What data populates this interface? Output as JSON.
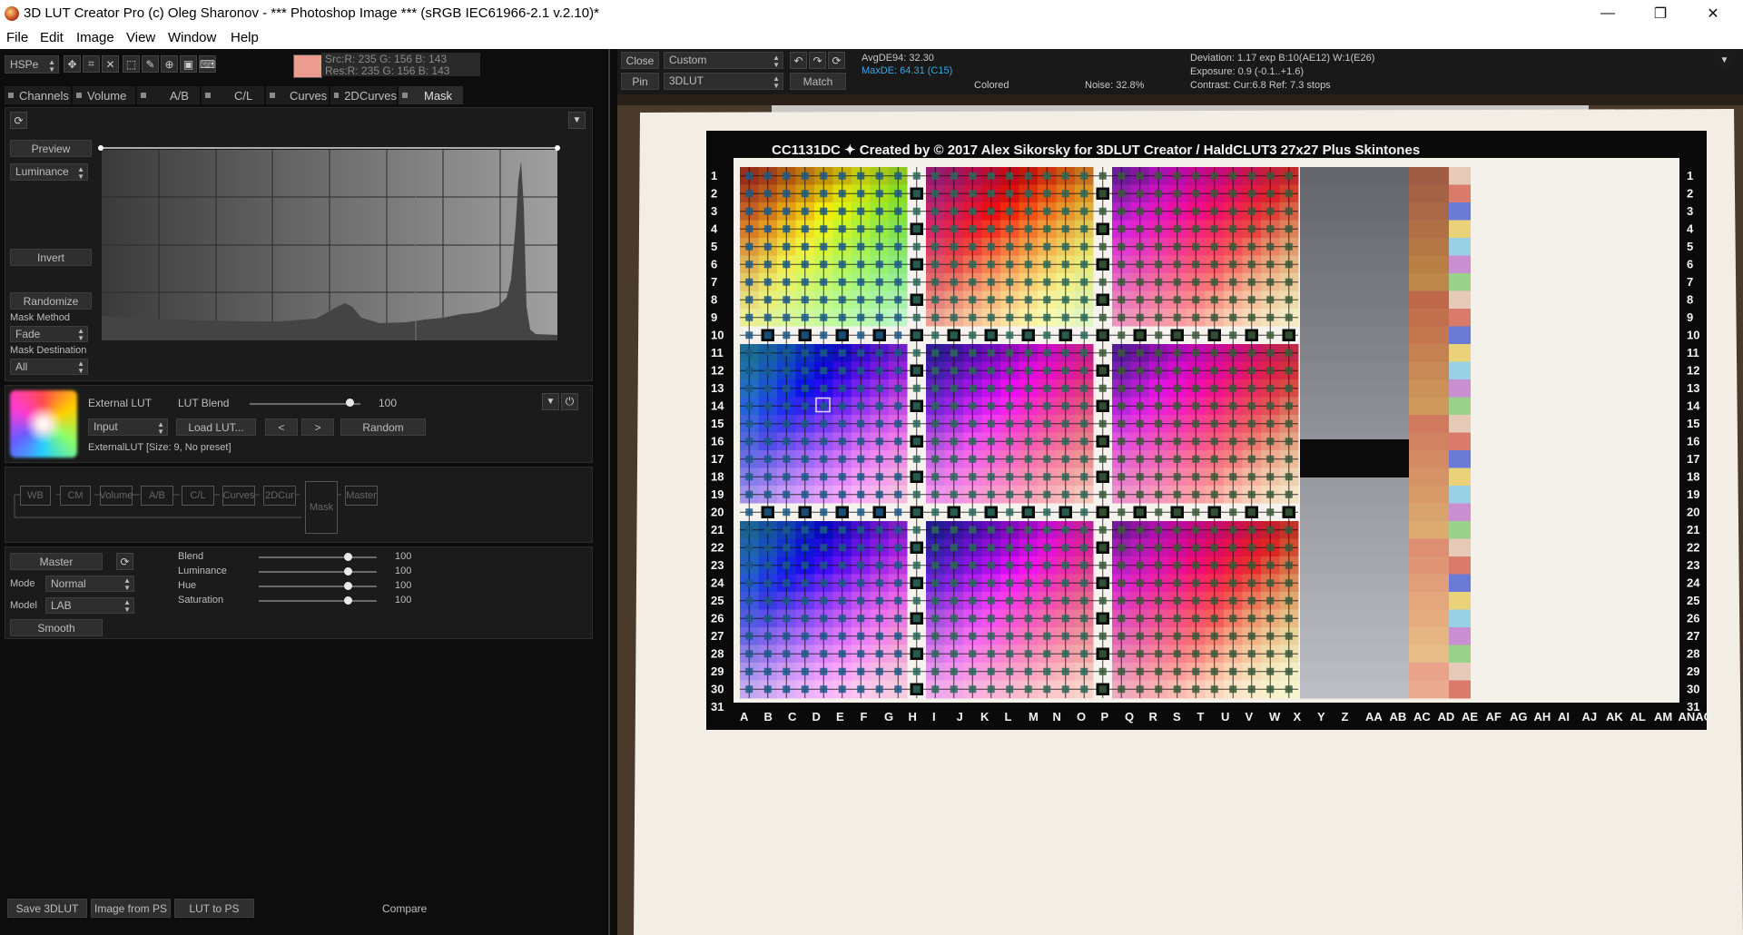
{
  "window": {
    "title": "3D LUT Creator Pro (c) Oleg Sharonov - *** Photoshop Image *** (sRGB IEC61966-2.1 v.2.10)*",
    "min_glyph": "—",
    "max_glyph": "❐",
    "close_glyph": "✕"
  },
  "menu": [
    "File",
    "Edit",
    "Image",
    "View",
    "Window",
    "Help"
  ],
  "toolbar": {
    "colorspace": "HSPe",
    "swatch_color": "#eb9c8f",
    "src_readout": "Src:R: 235  G: 156  B: 143",
    "res_readout": "Res:R: 235  G: 156  B: 143"
  },
  "tabs": [
    "Channels",
    "Volume",
    "A/B",
    "C/L",
    "Curves",
    "2DCurves",
    "Mask"
  ],
  "mask": {
    "preview": "Preview",
    "channel": "Luminance",
    "invert": "Invert",
    "randomize": "Randomize",
    "method_label": "Mask Method",
    "method_value": "Fade",
    "dest_label": "Mask Destination",
    "dest_value": "All"
  },
  "extlut": {
    "title": "External LUT",
    "blend_label": "LUT Blend",
    "blend_value": "100",
    "blend_fraction": 0.9,
    "input": "Input",
    "load": "Load LUT...",
    "prev": "<",
    "next": ">",
    "random": "Random",
    "status": "ExternalLUT [Size: 9, No preset]"
  },
  "flow": [
    "WB",
    "CM",
    "Volume",
    "A/B",
    "C/L",
    "Curves",
    "2DCur",
    "Mask",
    "Master"
  ],
  "master": {
    "label": "Master",
    "mode_label": "Mode",
    "mode_value": "Normal",
    "model_label": "Model",
    "model_value": "LAB",
    "smooth": "Smooth",
    "sliders": [
      {
        "label": "Blend",
        "value": "100",
        "fraction": 0.75
      },
      {
        "label": "Luminance",
        "value": "100",
        "fraction": 0.75
      },
      {
        "label": "Hue",
        "value": "100",
        "fraction": 0.75
      },
      {
        "label": "Saturation",
        "value": "100",
        "fraction": 0.75
      }
    ]
  },
  "bottom": {
    "save": "Save 3DLUT",
    "image_from_ps": "Image from PS",
    "lut_to_ps": "LUT to PS",
    "compare": "Compare"
  },
  "topright": {
    "close": "Close",
    "pin": "Pin",
    "preset": "Custom",
    "mode": "3DLUT",
    "match": "Match",
    "avg": "AvgDE94: 32.30",
    "max": "MaxDE: 64.31 (C15)",
    "colored": "Colored",
    "noise": "Noise: 32.8%",
    "deviation": "Deviation: 1.17 exp B:10(AE12) W:1(E26)",
    "exposure": "Exposure: 0.9 (-0.1..+1.6)",
    "contrast": "Contrast: Cur:6.8 Ref: 7.3 stops"
  },
  "chart": {
    "header": "CC1131DC ✦  Created by © 2017 Alex Sikorsky for 3DLUT Creator  /  HaldCLUT3 27x27 Plus Skintones",
    "columns": [
      "A",
      "B",
      "C",
      "D",
      "E",
      "F",
      "G",
      "H",
      "I",
      "J",
      "K",
      "L",
      "M",
      "N",
      "O",
      "P",
      "Q",
      "R",
      "S",
      "T",
      "U",
      "V",
      "W",
      "X",
      "Y",
      "Z",
      "AA",
      "AB",
      "AC",
      "AD",
      "AE",
      "AF",
      "AG",
      "AH",
      "AI",
      "AJ",
      "AK",
      "AL",
      "AM",
      "ANAO"
    ],
    "rows": [
      "1",
      "2",
      "3",
      "4",
      "5",
      "6",
      "7",
      "8",
      "9",
      "10",
      "11",
      "12",
      "13",
      "14",
      "15",
      "16",
      "17",
      "18",
      "19",
      "20",
      "21",
      "22",
      "23",
      "24",
      "25",
      "26",
      "27",
      "28",
      "29",
      "30",
      "31"
    ]
  }
}
